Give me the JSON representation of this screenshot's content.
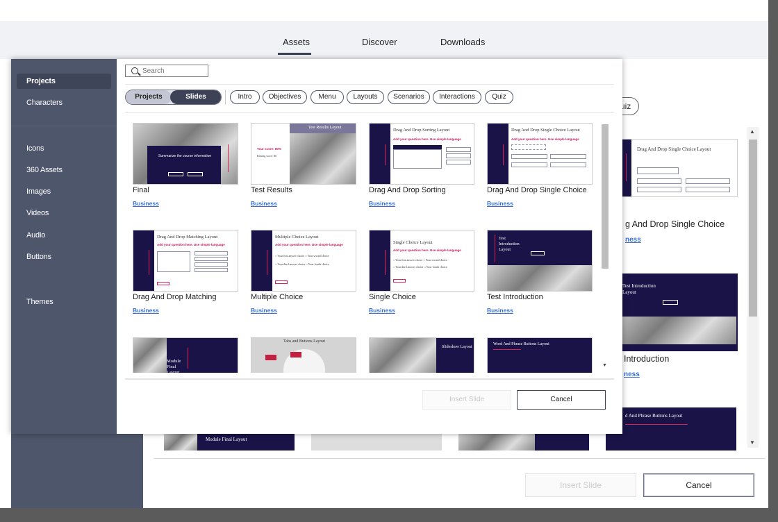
{
  "top_tabs": [
    {
      "label": "Assets",
      "active": true
    },
    {
      "label": "Discover",
      "active": false
    },
    {
      "label": "Downloads",
      "active": false
    }
  ],
  "sidebar": {
    "group1": [
      {
        "label": "Projects",
        "selected": true
      },
      {
        "label": "Characters",
        "selected": false
      }
    ],
    "group2": [
      {
        "label": "Icons"
      },
      {
        "label": "360 Assets"
      },
      {
        "label": "Images"
      },
      {
        "label": "Videos"
      },
      {
        "label": "Audio"
      },
      {
        "label": "Buttons"
      }
    ],
    "group3": [
      {
        "label": "Themes"
      }
    ]
  },
  "search": {
    "placeholder": "Search"
  },
  "toggle": {
    "left": "Projects",
    "right": "Slides",
    "active": "Slides"
  },
  "filters": [
    "Intro",
    "Objectives",
    "Menu",
    "Layouts",
    "Scenarios",
    "Interactions",
    "Quiz"
  ],
  "cards": [
    {
      "title": "Final",
      "category": "Business",
      "thumb_text": "Summarize the course information"
    },
    {
      "title": "Test Results",
      "category": "Business",
      "thumb_text": "Test Results Layout"
    },
    {
      "title": "Drag And Drop Sorting",
      "category": "Business",
      "thumb_text": "Drag And Drop Sorting Layout"
    },
    {
      "title": "Drag And Drop Single Choice",
      "category": "Business",
      "thumb_text": "Drag And Drop Single Choice Layout"
    },
    {
      "title": "Drag And Drop Matching",
      "category": "Business",
      "thumb_text": "Drag And Drop Matching Layout"
    },
    {
      "title": "Multiple Choice",
      "category": "Business",
      "thumb_text": "Multiple Choice Layout"
    },
    {
      "title": "Single Choice",
      "category": "Business",
      "thumb_text": "Single Choice Layout"
    },
    {
      "title": "Test Introduction",
      "category": "Business",
      "thumb_text": "Test Introduction Layout"
    },
    {
      "title": "",
      "category": "",
      "thumb_text": "Module Final Layout"
    },
    {
      "title": "",
      "category": "",
      "thumb_text": "Tabs and Buttons Layout"
    },
    {
      "title": "",
      "category": "",
      "thumb_text": "Slideshow Layout"
    },
    {
      "title": "",
      "category": "",
      "thumb_text": "Word And Phrase Buttons Layout"
    }
  ],
  "footer": {
    "insert": "Insert Slide",
    "cancel": "Cancel"
  },
  "background": {
    "quiz_chip": "uiz",
    "card1_title": "g And Drop Single Choice",
    "card1_category": "ness",
    "card2_title": "Introduction",
    "card2_category": "ness",
    "card1_thumb_text": "Drag And Drop Single Choice Layout",
    "card2_thumb_text": "Test Introduction Layout",
    "card3_thumb_text": "d And Phrase Buttons Layout",
    "module_thumb_text": "Module Final Layout",
    "insert": "Insert Slide",
    "cancel": "Cancel"
  },
  "colors": {
    "sidebar": "#4e566c",
    "slide_navy": "#1a1348",
    "accent_red": "#d92155",
    "link_blue": "#3b6fd0"
  }
}
